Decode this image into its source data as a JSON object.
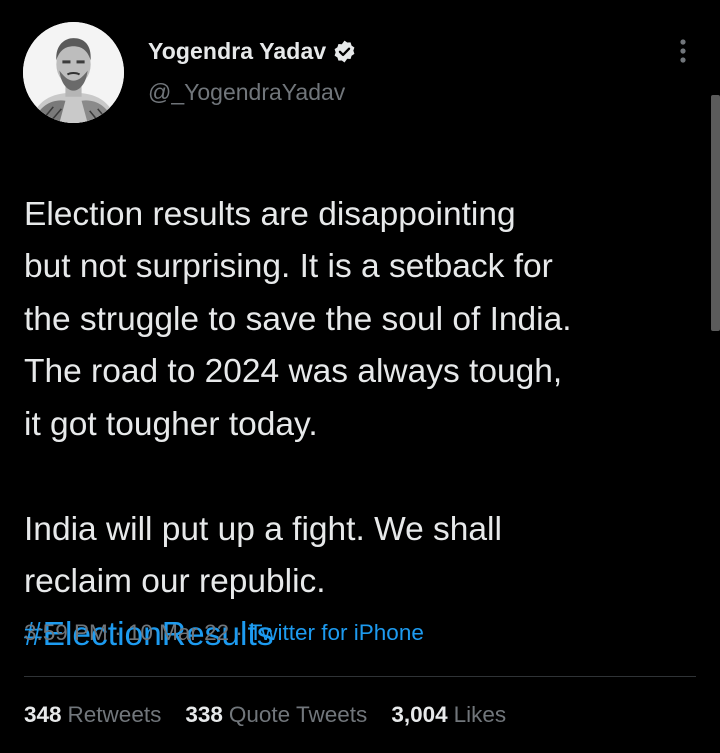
{
  "author": {
    "display_name": "Yogendra Yadav",
    "handle": "@_YogendraYadav",
    "avatar_icon": "profile-photo",
    "verified_icon": "verified-badge-icon",
    "more_icon": "more-vertical-icon"
  },
  "tweet": {
    "text": "Election results are disappointing\nbut not surprising. It is a setback for\nthe struggle to save the soul of India.\nThe road to 2024 was always tough,\nit got tougher today.\n\nIndia will put up a fight. We shall\nreclaim our republic.",
    "hashtag": "#ElectionResults",
    "time": "3:59 PM",
    "date": "10 Mar 22",
    "separator": "·",
    "source": "Twitter for iPhone"
  },
  "stats": {
    "retweets_count": "348",
    "retweets_label": "Retweets",
    "quotes_count": "338",
    "quotes_label": "Quote Tweets",
    "likes_count": "3,004",
    "likes_label": "Likes"
  },
  "colors": {
    "background": "#000000",
    "text_primary": "#e7e9ea",
    "text_secondary": "#71767b",
    "link": "#1d9bf0",
    "divider": "#2f3336"
  }
}
